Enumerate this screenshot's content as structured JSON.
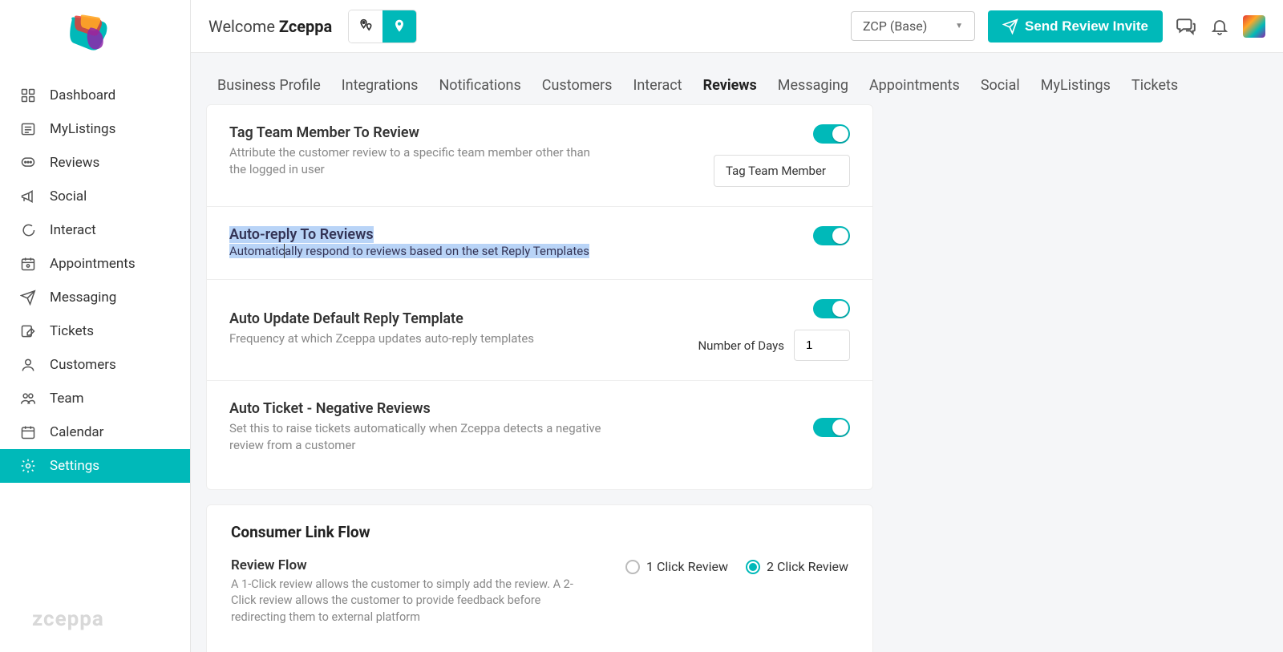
{
  "sidebar": {
    "items": [
      {
        "label": "Dashboard",
        "icon": "grid"
      },
      {
        "label": "MyListings",
        "icon": "list"
      },
      {
        "label": "Reviews",
        "icon": "chat-dots"
      },
      {
        "label": "Social",
        "icon": "megaphone"
      },
      {
        "label": "Interact",
        "icon": "speech"
      },
      {
        "label": "Appointments",
        "icon": "calendar"
      },
      {
        "label": "Messaging",
        "icon": "paper-plane"
      },
      {
        "label": "Tickets",
        "icon": "edit"
      },
      {
        "label": "Customers",
        "icon": "person"
      },
      {
        "label": "Team",
        "icon": "people"
      },
      {
        "label": "Calendar",
        "icon": "calendar2"
      },
      {
        "label": "Settings",
        "icon": "gear",
        "active": true
      }
    ],
    "watermark": "zceppa"
  },
  "header": {
    "welcome_prefix": "Welcome ",
    "welcome_name": "Zceppa",
    "location_selector": {
      "selected": "ZCP (Base)"
    },
    "send_button": "Send Review Invite"
  },
  "tabs": [
    "Business Profile",
    "Integrations",
    "Notifications",
    "Customers",
    "Interact",
    "Reviews",
    "Messaging",
    "Appointments",
    "Social",
    "MyListings",
    "Tickets"
  ],
  "active_tab": "Reviews",
  "settings": {
    "tag_member": {
      "title": "Tag Team Member To Review",
      "desc": "Attribute the customer review to a specific team member other than the logged in user",
      "button_label": "Tag Team Member",
      "enabled": true
    },
    "auto_reply": {
      "title": "Auto-reply To Reviews",
      "desc": "Automatically respond to reviews based on the set Reply Templates",
      "enabled": true,
      "highlighted": true
    },
    "auto_update_template": {
      "title": "Auto Update Default Reply Template",
      "desc": "Frequency at which Zceppa updates auto-reply templates",
      "days_label": "Number of Days",
      "days_value": "1",
      "enabled": true
    },
    "auto_ticket": {
      "title": "Auto Ticket - Negative Reviews",
      "desc": "Set this to raise tickets automatically when Zceppa detects a negative review from a customer",
      "enabled": true
    }
  },
  "consumer_link": {
    "section_title": "Consumer Link Flow",
    "flow_title": "Review Flow",
    "flow_desc": "A 1-Click review allows the customer to simply add the review. A 2-Click review allows the customer to provide feedback before redirecting them to external platform",
    "options": [
      "1 Click Review",
      "2 Click Review"
    ],
    "selected": "2 Click Review"
  }
}
